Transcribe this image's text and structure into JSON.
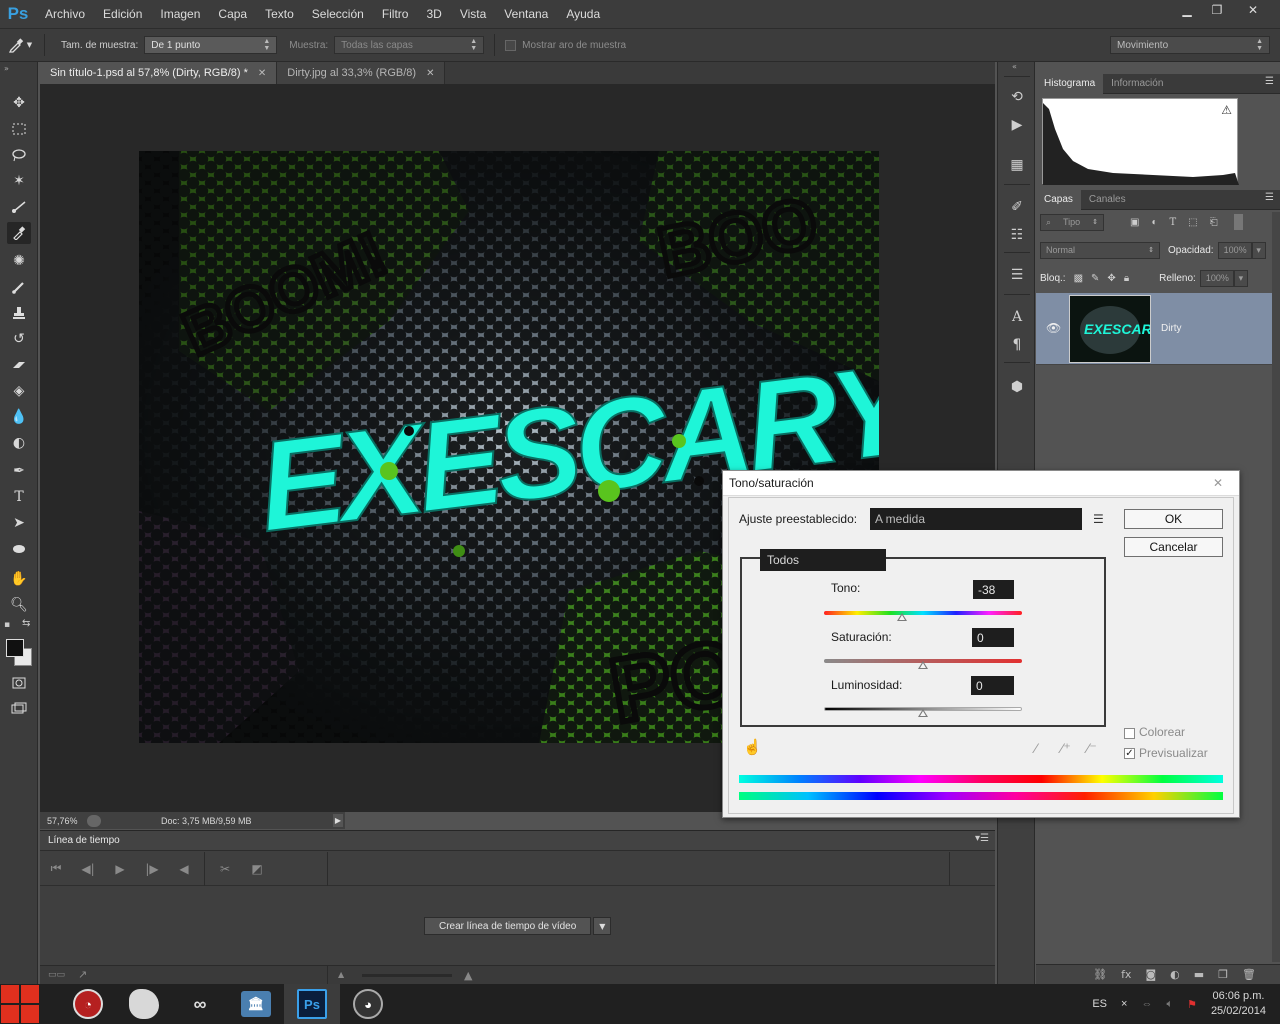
{
  "app": {
    "logo": "Ps"
  },
  "menu": [
    "Archivo",
    "Edición",
    "Imagen",
    "Capa",
    "Texto",
    "Selección",
    "Filtro",
    "3D",
    "Vista",
    "Ventana",
    "Ayuda"
  ],
  "window_controls": {
    "minimize": "▁",
    "restore": "❐",
    "close": "✕"
  },
  "options_bar": {
    "sample_size_label": "Tam. de muestra:",
    "sample_size_value": "De 1 punto",
    "sample_label": "Muestra:",
    "sample_value": "Todas las capas",
    "show_ring_label": "Mostrar aro de muestra",
    "workspace": "Movimiento"
  },
  "tabs": [
    {
      "label": "Sin título-1.psd al 57,8% (Dirty, RGB/8) *",
      "active": true
    },
    {
      "label": "Dirty.jpg al 33,3% (RGB/8)",
      "active": false
    }
  ],
  "artwork": {
    "text": "EXESCARY",
    "accent": "#1ef5d8",
    "green": "#59c41e"
  },
  "status": {
    "zoom": "57,76%",
    "doc": "Doc: 3,75 MB/9,59 MB"
  },
  "timeline": {
    "title": "Línea de tiempo",
    "create_button": "Crear línea de tiempo de vídeo"
  },
  "panels": {
    "top_tabs": [
      "Histograma",
      "Información"
    ],
    "layer_tabs": [
      "Capas",
      "Canales"
    ],
    "filter_kind": "Tipo",
    "blend_mode": "Normal",
    "opacity_label": "Opacidad:",
    "opacity_value": "100%",
    "lock_label": "Bloq.:",
    "fill_label": "Relleno:",
    "fill_value": "100%",
    "layer_name": "Dirty"
  },
  "dialog": {
    "title": "Tono/saturación",
    "preset_label": "Ajuste preestablecido:",
    "preset_value": "A medida",
    "channel": "Todos",
    "hue_label": "Tono:",
    "hue_value": "-38",
    "saturation_label": "Saturación:",
    "saturation_value": "0",
    "lightness_label": "Luminosidad:",
    "lightness_value": "0",
    "ok": "OK",
    "cancel": "Cancelar",
    "colorize_label": "Colorear",
    "preview_label": "Previsualizar",
    "hue_fraction": 0.395,
    "saturation_fraction": 0.5,
    "lightness_fraction": 0.5
  },
  "taskbar": {
    "language": "ES",
    "time": "06:06 p.m.",
    "date": "25/02/2014",
    "ps_label": "Ps"
  }
}
